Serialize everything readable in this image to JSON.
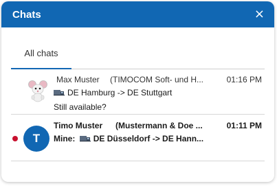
{
  "header": {
    "title": "Chats",
    "close_symbol": "×"
  },
  "tabs": [
    {
      "label": "All chats",
      "active": true
    }
  ],
  "colors": {
    "accent": "#1167b3",
    "unread": "#c8102e"
  },
  "chats": [
    {
      "name": "Max Muster",
      "company": "(TIMOCOM Soft- und H...",
      "time": "01:16 PM",
      "route": "DE Hamburg -> DE Stuttgart",
      "message": "Still available?",
      "avatar": "mouse-mascot-icon",
      "unread": false
    },
    {
      "name": "Timo Muster",
      "company": "(Mustermann & Doe ...",
      "time": "01:11 PM",
      "route": "Mine: 🚚 DE Düsseldorf -> DE Hann...",
      "route_text": "DE Düsseldorf -> DE Hann...",
      "route_prefix": "Mine:",
      "avatar_initial": "T",
      "unread": true
    }
  ]
}
